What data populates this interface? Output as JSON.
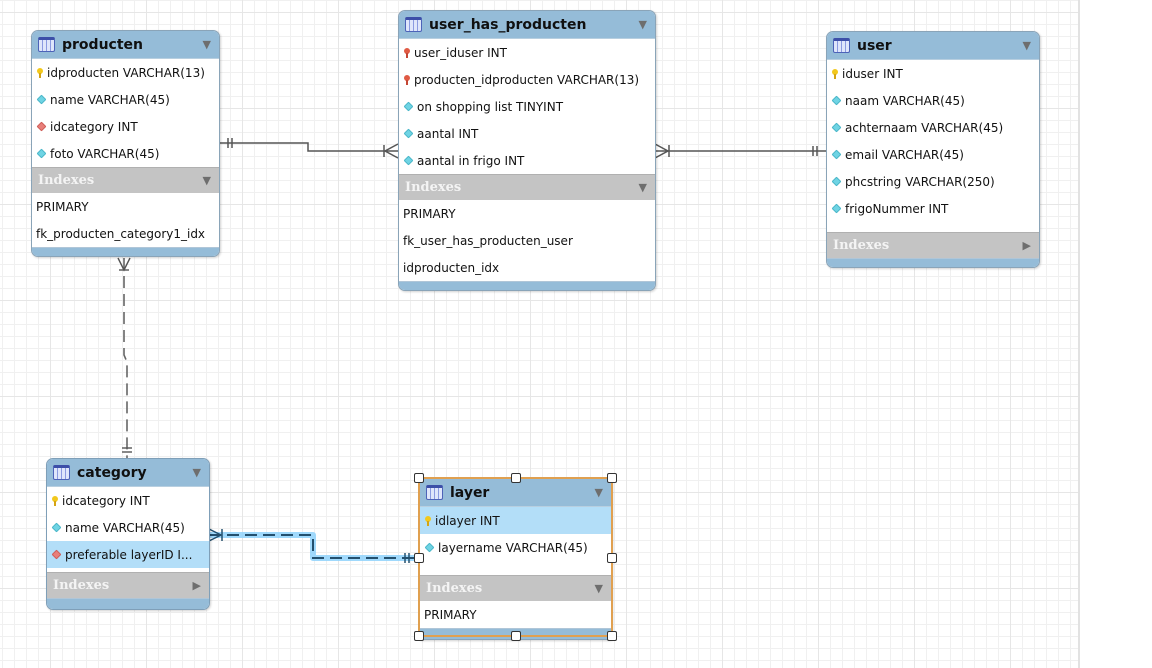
{
  "diagram": {
    "tables": {
      "producten": {
        "name": "producten",
        "columns": [
          {
            "icon": "primary-key-icon",
            "text": "idproducten VARCHAR(13)"
          },
          {
            "icon": "column-icon",
            "text": "name VARCHAR(45)"
          },
          {
            "icon": "foreign-key-icon",
            "text": "idcategory INT"
          },
          {
            "icon": "column-icon",
            "text": "foto VARCHAR(45)"
          }
        ],
        "indexes_label": "Indexes",
        "indexes_expanded": true,
        "indexes": [
          "PRIMARY",
          "fk_producten_category1_idx"
        ]
      },
      "user_has_producten": {
        "name": "user_has_producten",
        "columns": [
          {
            "icon": "primary-foreign-key-icon",
            "text": "user_iduser INT"
          },
          {
            "icon": "primary-foreign-key-icon",
            "text": "producten_idproducten VARCHAR(13)"
          },
          {
            "icon": "column-icon",
            "text": "on shopping list TINYINT"
          },
          {
            "icon": "column-icon",
            "text": "aantal INT"
          },
          {
            "icon": "column-icon",
            "text": "aantal in frigo INT"
          }
        ],
        "indexes_label": "Indexes",
        "indexes_expanded": true,
        "indexes": [
          "PRIMARY",
          "fk_user_has_producten_user",
          "idproducten_idx"
        ]
      },
      "user": {
        "name": "user",
        "columns": [
          {
            "icon": "primary-key-icon",
            "text": "iduser INT"
          },
          {
            "icon": "column-icon",
            "text": "naam VARCHAR(45)"
          },
          {
            "icon": "column-icon",
            "text": "achternaam VARCHAR(45)"
          },
          {
            "icon": "column-icon",
            "text": "email VARCHAR(45)"
          },
          {
            "icon": "column-icon",
            "text": "phcstring VARCHAR(250)"
          },
          {
            "icon": "column-icon",
            "text": "frigoNummer INT"
          }
        ],
        "indexes_label": "Indexes",
        "indexes_expanded": false,
        "indexes": []
      },
      "category": {
        "name": "category",
        "columns": [
          {
            "icon": "primary-key-icon",
            "text": "idcategory INT"
          },
          {
            "icon": "column-icon",
            "text": "name VARCHAR(45)"
          },
          {
            "icon": "foreign-key-icon",
            "text": "preferable layerID I...",
            "highlighted": true
          }
        ],
        "indexes_label": "Indexes",
        "indexes_expanded": false,
        "indexes": []
      },
      "layer": {
        "name": "layer",
        "selected": true,
        "columns": [
          {
            "icon": "primary-key-icon",
            "text": "idlayer INT",
            "highlighted": true
          },
          {
            "icon": "column-icon",
            "text": "layername VARCHAR(45)"
          }
        ],
        "indexes_label": "Indexes",
        "indexes_expanded": true,
        "indexes": [
          "PRIMARY"
        ]
      }
    },
    "relationships": [
      {
        "from": "producten",
        "to": "user_has_producten",
        "style": "solid",
        "from_end": "one-mandatory",
        "to_end": "many-mandatory"
      },
      {
        "from": "user",
        "to": "user_has_producten",
        "style": "solid",
        "from_end": "one-mandatory",
        "to_end": "many-mandatory"
      },
      {
        "from": "category",
        "to": "producten",
        "style": "dashed",
        "from_end": "one-mandatory",
        "to_end": "many-optional"
      },
      {
        "from": "layer",
        "to": "category",
        "style": "dashed",
        "from_end": "one-mandatory",
        "to_end": "many-mandatory",
        "highlighted": true
      }
    ],
    "colors": {
      "header": "#95bcd8",
      "indexes_header": "#c4c4c4",
      "highlight_row": "#b3def8",
      "selection_border": "#e0a050",
      "relationship_highlight": "#5ab8f0"
    }
  }
}
